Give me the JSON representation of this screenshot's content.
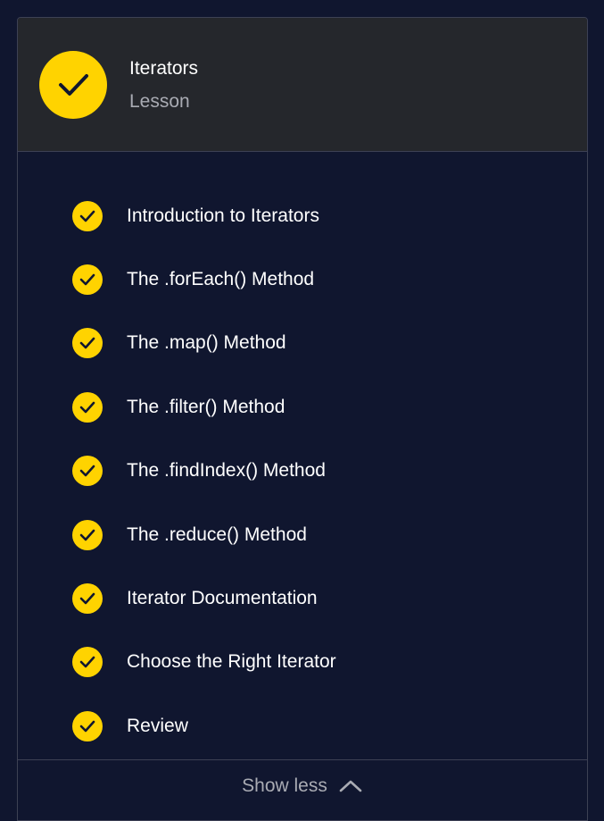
{
  "lesson": {
    "title": "Iterators",
    "type_label": "Lesson",
    "status": "completed"
  },
  "items": [
    {
      "label": "Introduction to Iterators",
      "status": "completed"
    },
    {
      "label": "The .forEach() Method",
      "status": "completed"
    },
    {
      "label": "The .map() Method",
      "status": "completed"
    },
    {
      "label": "The .filter() Method",
      "status": "completed"
    },
    {
      "label": "The .findIndex() Method",
      "status": "completed"
    },
    {
      "label": "The .reduce() Method",
      "status": "completed"
    },
    {
      "label": "Iterator Documentation",
      "status": "completed"
    },
    {
      "label": "Choose the Right Iterator",
      "status": "completed"
    },
    {
      "label": "Review",
      "status": "completed"
    }
  ],
  "footer": {
    "toggle_label": "Show less",
    "toggle_icon": "chevron-up-icon"
  },
  "colors": {
    "background": "#10162f",
    "header_bg": "#25272c",
    "accent": "#ffd300",
    "border": "#3d4154",
    "text_primary": "#ffffff",
    "text_secondary": "#a9abb3"
  }
}
